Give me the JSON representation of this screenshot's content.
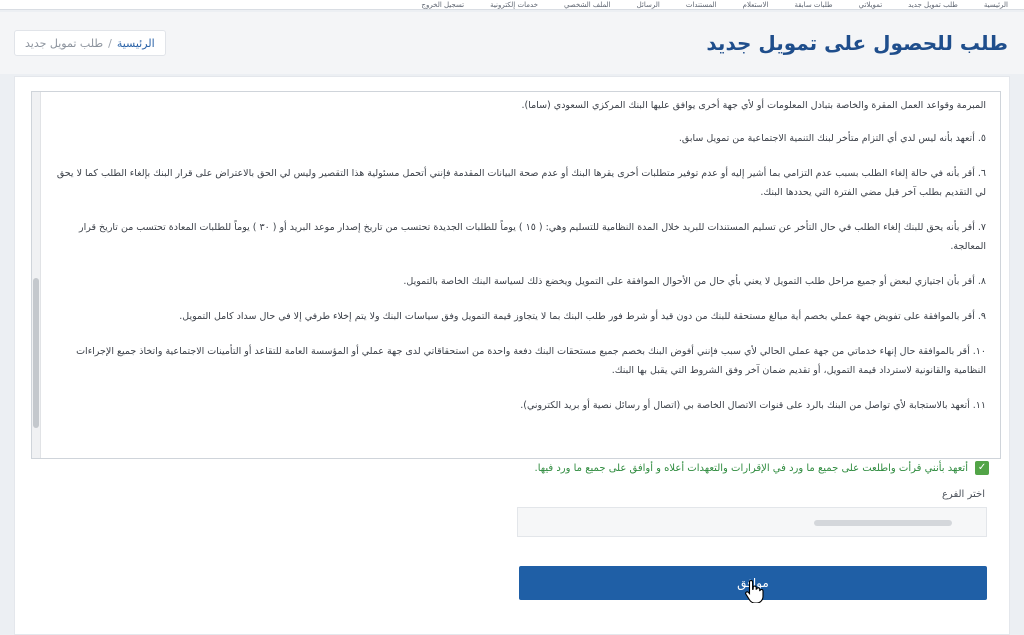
{
  "topbar": {
    "items": [
      {
        "label": "الرئيسية"
      },
      {
        "label": "طلب تمويل جديد"
      },
      {
        "label": "تمويلاتي"
      },
      {
        "label": "طلبات سابقة"
      },
      {
        "label": "الاستعلام"
      },
      {
        "label": "المستندات"
      },
      {
        "label": "الرسائل"
      },
      {
        "label": "الملف الشخصي"
      },
      {
        "label": "خدمات إلكترونية"
      },
      {
        "label": "تسجيل الخروج"
      }
    ]
  },
  "header": {
    "title": "طلب للحصول على تمويل جديد",
    "breadcrumb": {
      "home": "الرئيسية",
      "separator": "/",
      "current": "طلب تمويل جديد"
    }
  },
  "terms": {
    "first_line": "المبرمة وقواعد العمل المقرة والخاصة بتبادل المعلومات أو لأي جهة أخرى يوافق عليها البنك المركزي السعودي (ساما).",
    "items": [
      {
        "text": "٥. أتعهد بأنه ليس لدي أي التزام متأخر لبنك التنمية الاجتماعية من تمويل سابق."
      },
      {
        "text": "٦. أقر بأنه في حالة إلغاء الطلب بسبب عدم التزامي بما أشير إليه أو عدم توفير متطلبات أخرى يقرها البنك أو عدم صحة البيانات المقدمة فإنني أتحمل مسئولية هذا التقصير وليس لي الحق بالاعتراض على قرار البنك بإلغاء الطلب كما لا يحق لي التقديم بطلب آخر قبل مضي الفترة التي يحددها البنك."
      },
      {
        "text": "٧. أقر بأنه يحق للبنك إلغاء الطلب في حال التأخر عن تسليم المستندات للبريد خلال المدة النظامية للتسليم وهي: ( ١٥ ) يوماً للطلبات الجديدة تحتسب من تاريخ إصدار موعد البريد أو ( ٣٠ ) يوماً للطلبات المعادة تحتسب من تاريخ قرار المعالجة."
      },
      {
        "text": "٨. أقر بأن اجتيازي لبعض أو جميع مراحل طلب التمويل لا يعني بأي حال من الأحوال الموافقة على التمويل ويخضع ذلك لسياسة البنك الخاصة بالتمويل."
      },
      {
        "text": "٩. أقر بالموافقة على تفويض جهة عملي بخصم أية مبالغ مستحقة للبنك من دون قيد أو شرط فور طلب البنك بما لا يتجاوز قيمة التمويل وفق سياسات البنك ولا يتم إخلاء طرفي إلا في حال سداد كامل التمويل."
      },
      {
        "text": "١٠. أقر بالموافقة حال إنهاء خدماتي من جهة عملي الحالي لأي سبب فإنني أفوض البنك بخصم جميع مستحقات البنك دفعة واحدة من استحقاقاتي لدى جهة عملي أو المؤسسة العامة للتقاعد أو التأمينات الاجتماعية واتخاذ جميع الإجراءات النظامية والقانونية لاسترداد قيمة التمويل، أو تقديم ضمان آخر وفق الشروط التي يقبل بها البنك."
      },
      {
        "text": "١١. أتعهد بالاستجابة لأي تواصل من البنك بالرد على قنوات الاتصال الخاصة بي (اتصال أو رسائل نصية أو بريد الكتروني)."
      }
    ]
  },
  "agreement": {
    "checked": true,
    "check_mark": "✓",
    "label": "أتعهد بأنني قرأت واطلعت على جميع ما ورد في الإقرارات والتعهدات أعلاه و أوافق على جميع ما ورد فيها."
  },
  "branch": {
    "label": "اختر الفرع"
  },
  "submit": {
    "label": "موافق"
  },
  "colors": {
    "title": "#1f4e8c",
    "button": "#1f5fa6",
    "checkbox": "#52a447",
    "agree_text": "#2e8b3e"
  }
}
